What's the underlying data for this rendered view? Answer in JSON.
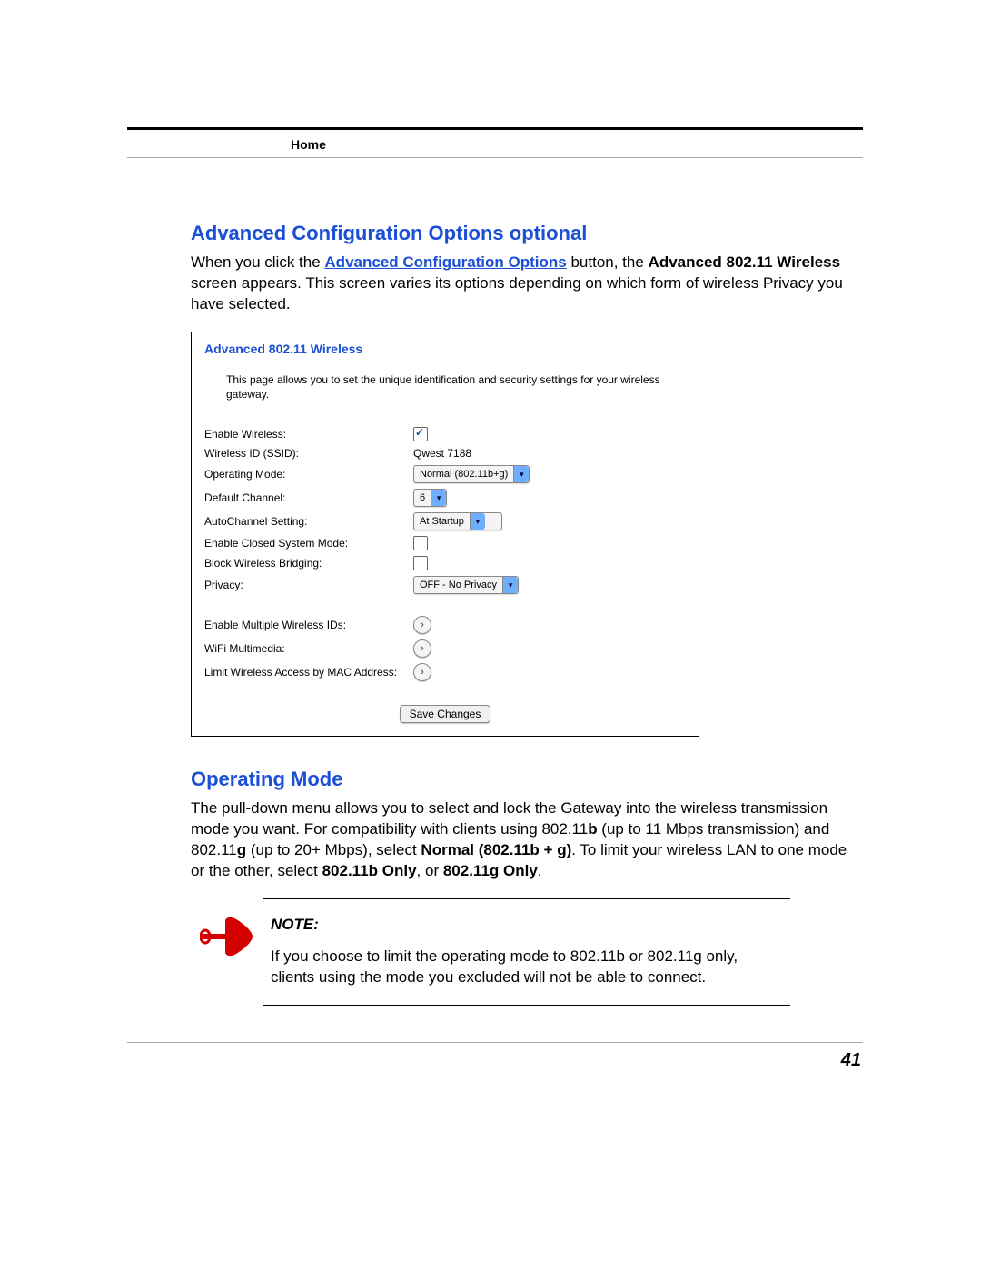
{
  "header": {
    "breadcrumb": "Home"
  },
  "section1": {
    "title": "Advanced Configuration Options optional",
    "intro_1": "When you click the ",
    "intro_link": "Advanced Configuration Options",
    "intro_2": " button, the ",
    "intro_bold": "Advanced 802.11 Wireless",
    "intro_3": " screen appears. This screen varies its options depending on which form of wireless Privacy you have selected."
  },
  "panel": {
    "title": "Advanced 802.11 Wireless",
    "desc": "This page allows you to set the unique identification and security settings for your wireless gateway.",
    "rows": {
      "enable_wireless": "Enable Wireless:",
      "ssid_label": "Wireless ID (SSID):",
      "ssid_value": "Qwest 7188",
      "op_mode_label": "Operating Mode:",
      "op_mode_value": "Normal (802.11b+g)",
      "channel_label": "Default Channel:",
      "channel_value": "6",
      "autoch_label": "AutoChannel Setting:",
      "autoch_value": "At Startup",
      "closed_label": "Enable Closed System Mode:",
      "block_label": "Block Wireless Bridging:",
      "privacy_label": "Privacy:",
      "privacy_value": "OFF - No Privacy",
      "multi_label": "Enable Multiple Wireless IDs:",
      "wmm_label": "WiFi Multimedia:",
      "mac_label": "Limit Wireless Access by MAC Address:"
    },
    "save": "Save Changes"
  },
  "section2": {
    "title": "Operating Mode",
    "p1a": "The pull-down menu allows you to select and lock the Gateway into the wireless transmission mode you want. For compatibility with clients using 802.11",
    "p1b": "b",
    "p1c": " (up to 11 Mbps transmission) and 802.11",
    "p1d": "g",
    "p1e": " (up to 20+ Mbps), select ",
    "p1f": "Normal (802.11b + g)",
    "p1g": ". To limit your wireless LAN to one mode or the other, select ",
    "p1h": "802.11b Only",
    "p1i": ", or ",
    "p1j": "802.11g Only",
    "p1k": "."
  },
  "note": {
    "label": "NOTE:",
    "text": "If you choose to limit the operating mode to 802.11b or 802.11g only, clients using the mode you excluded will not be able to connect."
  },
  "page_number": "41"
}
